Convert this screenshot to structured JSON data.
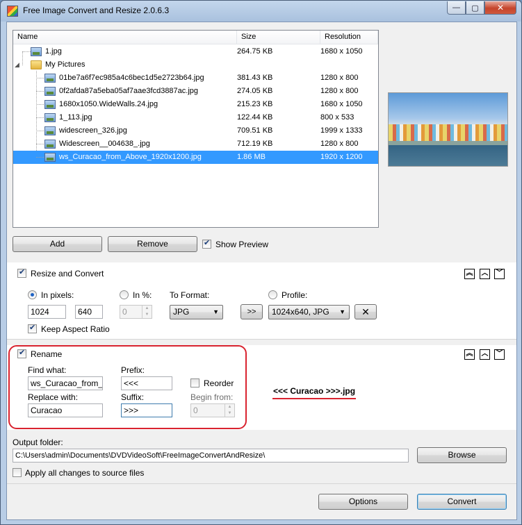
{
  "window": {
    "title": "Free Image Convert and Resize 2.0.6.3",
    "minimize_icon": "minimize-icon",
    "maximize_icon": "maximize-icon",
    "close_icon": "close-icon",
    "minimize_glyph": "—",
    "maximize_glyph": "▢",
    "close_glyph": "✕"
  },
  "file_list": {
    "columns": {
      "name": "Name",
      "size": "Size",
      "resolution": "Resolution"
    },
    "rows": [
      {
        "name": "1.jpg",
        "size": "264.75 KB",
        "resolution": "1680 x 1050",
        "icon": "image-file-icon"
      },
      {
        "name": "My Pictures",
        "size": "",
        "resolution": "",
        "icon": "folder-icon"
      },
      {
        "name": "01be7a6f7ec985a4c6bec1d5e2723b64.jpg",
        "size": "381.43 KB",
        "resolution": "1280 x 800",
        "icon": "image-file-icon"
      },
      {
        "name": "0f2afda87a5eba05af7aae3fcd3887ac.jpg",
        "size": "274.05 KB",
        "resolution": "1280 x 800",
        "icon": "image-file-icon"
      },
      {
        "name": "1680x1050.WideWalls.24.jpg",
        "size": "215.23 KB",
        "resolution": "1680 x 1050",
        "icon": "image-file-icon"
      },
      {
        "name": "1_113.jpg",
        "size": "122.44 KB",
        "resolution": "800 x 533",
        "icon": "image-file-icon"
      },
      {
        "name": "widescreen_326.jpg",
        "size": "709.51 KB",
        "resolution": "1999 x 1333",
        "icon": "image-file-icon"
      },
      {
        "name": "Widescreen__004638_.jpg",
        "size": "712.19 KB",
        "resolution": "1280 x 800",
        "icon": "image-file-icon"
      },
      {
        "name": "ws_Curacao_from_Above_1920x1200.jpg",
        "size": "1.86 MB",
        "resolution": "1920 x 1200",
        "icon": "image-file-icon",
        "selected": true
      }
    ]
  },
  "buttons": {
    "add": "Add",
    "remove": "Remove",
    "show_preview": "Show Preview",
    "browse": "Browse",
    "options": "Options",
    "convert": "Convert"
  },
  "resize": {
    "section_title": "Resize and Convert",
    "in_pixels_label": "In pixels:",
    "in_percent_label": "In %:",
    "to_format_label": "To Format:",
    "profile_label": "Profile:",
    "width": "1024",
    "height": "640",
    "percent": "0",
    "format": "JPG",
    "apply_profile": ">>",
    "profile": "1024x640, JPG",
    "delete_profile_icon": "delete-x-icon",
    "keep_aspect": "Keep Aspect Ratio"
  },
  "rename": {
    "section_title": "Rename",
    "find_label": "Find what:",
    "find_value": "ws_Curacao_from_Ab",
    "replace_label": "Replace with:",
    "replace_value": "Curacao",
    "prefix_label": "Prefix:",
    "prefix_value": "<<<",
    "suffix_label": "Suffix:",
    "suffix_value": ">>>",
    "reorder_label": "Reorder",
    "begin_label": "Begin from:",
    "begin_value": "0",
    "result_preview": "<<< Curacao >>>.jpg"
  },
  "section_controls": {
    "collapse_all": "︽",
    "up": "︿",
    "down": "﹀"
  },
  "output": {
    "label": "Output folder:",
    "path": "C:\\Users\\admin\\Documents\\DVDVideoSoft\\FreeImageConvertAndResize\\",
    "apply_to_source": "Apply all changes to source files"
  },
  "colors": {
    "selection": "#3399ff",
    "annotation_red": "#d9232f"
  }
}
